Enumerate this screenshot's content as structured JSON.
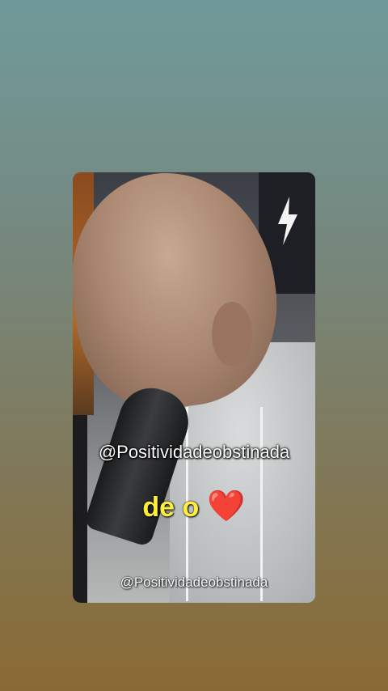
{
  "overlay": {
    "handle_main": "@Positividadeobstinada",
    "caption_text": "de o",
    "caption_emoji": "❤️",
    "handle_small": "@Positividadeobstinada"
  },
  "colors": {
    "caption": "#ffee3a",
    "heart": "#e01b1b",
    "handle": "#ffffff"
  },
  "icons": {
    "heart": "heart-icon"
  }
}
